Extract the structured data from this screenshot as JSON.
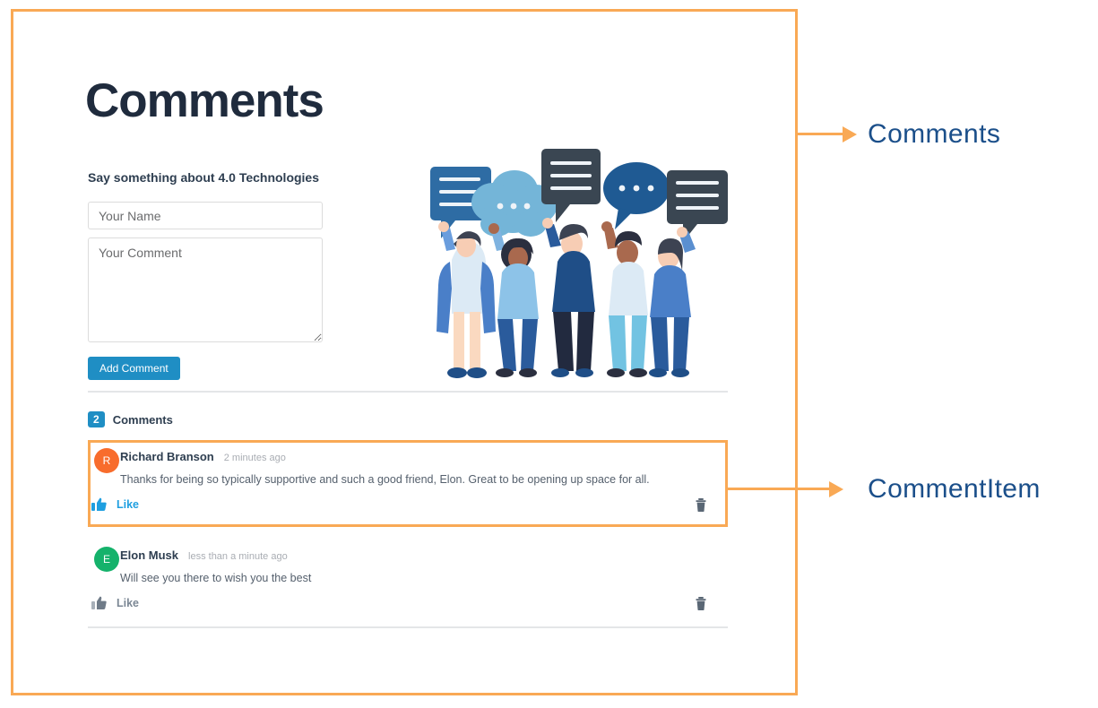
{
  "page": {
    "title": "Comments",
    "form": {
      "prompt": "Say something about 4.0 Technologies",
      "name_placeholder": "Your Name",
      "name_value": "",
      "comment_placeholder": "Your Comment",
      "comment_value": "",
      "submit_label": "Add Comment"
    },
    "count": {
      "badge": "2",
      "label": "Comments"
    },
    "comments": [
      {
        "initial": "R",
        "avatar_color": "#f86c2c",
        "author": "Richard Branson",
        "time": "2 minutes ago",
        "body": "Thanks for being so typically supportive and such a good friend, Elon. Great to be opening up space for all.",
        "like_label": "Like",
        "liked": true
      },
      {
        "initial": "E",
        "avatar_color": "#15b26b",
        "author": "Elon Musk",
        "time": "less than a minute ago",
        "body": "Will see you there to wish you the best",
        "like_label": "Like",
        "liked": false
      }
    ]
  },
  "annotations": {
    "frame_color": "#f9a955",
    "label_color": "#1b4f8a",
    "items": [
      {
        "label": "Comments"
      },
      {
        "label": "CommentItem"
      }
    ]
  }
}
